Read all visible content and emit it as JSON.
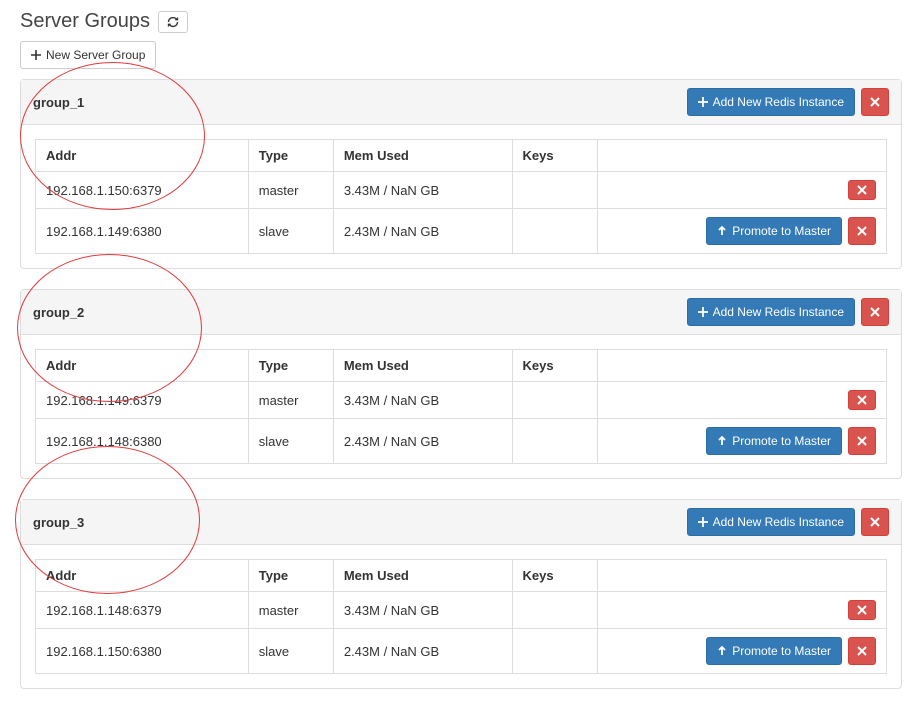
{
  "page_title": "Server Groups",
  "buttons": {
    "new_server_group": "New Server Group",
    "add_new_redis_instance": "Add New Redis Instance",
    "promote_to_master": "Promote to Master"
  },
  "table_headers": {
    "addr": "Addr",
    "type": "Type",
    "mem_used": "Mem Used",
    "keys": "Keys"
  },
  "groups": [
    {
      "name": "group_1",
      "rows": [
        {
          "addr": "192.168.1.150:6379",
          "type": "master",
          "mem_used": "3.43M / NaN GB",
          "keys": ""
        },
        {
          "addr": "192.168.1.149:6380",
          "type": "slave",
          "mem_used": "2.43M / NaN GB",
          "keys": ""
        }
      ]
    },
    {
      "name": "group_2",
      "rows": [
        {
          "addr": "192.168.1.149:6379",
          "type": "master",
          "mem_used": "3.43M / NaN GB",
          "keys": ""
        },
        {
          "addr": "192.168.1.148:6380",
          "type": "slave",
          "mem_used": "2.43M / NaN GB",
          "keys": ""
        }
      ]
    },
    {
      "name": "group_3",
      "rows": [
        {
          "addr": "192.168.1.148:6379",
          "type": "master",
          "mem_used": "3.43M / NaN GB",
          "keys": ""
        },
        {
          "addr": "192.168.1.150:6380",
          "type": "slave",
          "mem_used": "2.43M / NaN GB",
          "keys": ""
        }
      ]
    }
  ]
}
